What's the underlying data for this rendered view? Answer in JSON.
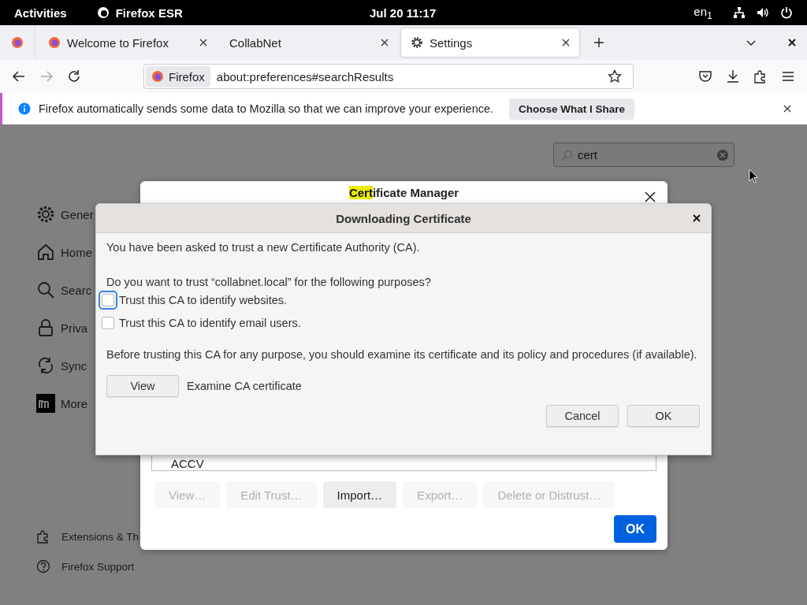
{
  "top_bar": {
    "activities": "Activities",
    "app_name": "Firefox ESR",
    "clock": "Jul 20  11:17",
    "keyboard": "en$_{1}$"
  },
  "tabs": [
    {
      "label": "Welcome to Firefox",
      "selected": false
    },
    {
      "label": "CollabNet",
      "selected": false
    },
    {
      "label": "Settings",
      "selected": true
    }
  ],
  "nav": {
    "forward_disabled": true,
    "identity": "Firefox",
    "url": "about:preferences#searchResults"
  },
  "notification": {
    "message": "Firefox automatically sends some data to Mozilla so that we can improve your experience.",
    "button": "Choose What I Share"
  },
  "search": {
    "value": "cert"
  },
  "sidebar": {
    "items": [
      {
        "label": "Gener"
      },
      {
        "label": "Home"
      },
      {
        "label": "Searc"
      },
      {
        "label": "Priva"
      },
      {
        "label": "Sync"
      },
      {
        "label": "More"
      }
    ],
    "footer": [
      {
        "label": "Extensions & Th"
      },
      {
        "label": "Firefox Support"
      }
    ]
  },
  "certificate_manager": {
    "title_match": "Cert",
    "title_rest": "ificate Manager",
    "tree_item": "ACCV",
    "buttons": [
      {
        "label": "View…",
        "disabled": true
      },
      {
        "label": "Edit Trust…",
        "disabled": true
      },
      {
        "label": "Import…",
        "disabled": false
      },
      {
        "label": "Export…",
        "disabled": true
      },
      {
        "label": "Delete or Distrust…",
        "disabled": true
      }
    ],
    "ok": "OK"
  },
  "download_dialog": {
    "title": "Downloading Certificate",
    "intro": "You have been asked to trust a new Certificate Authority (CA).",
    "question": "Do you want to trust “collabnet.local” for the following purposes?",
    "options": [
      {
        "label": "Trust this CA to identify websites.",
        "checked": false,
        "focused": true
      },
      {
        "label": "Trust this CA to identify email users.",
        "checked": false,
        "focused": false
      }
    ],
    "advice": "Before trusting this CA for any purpose, you should examine its certificate and its policy and procedures (if available).",
    "view_button": "View",
    "view_label": "Examine CA certificate",
    "cancel": "Cancel",
    "ok": "OK"
  }
}
